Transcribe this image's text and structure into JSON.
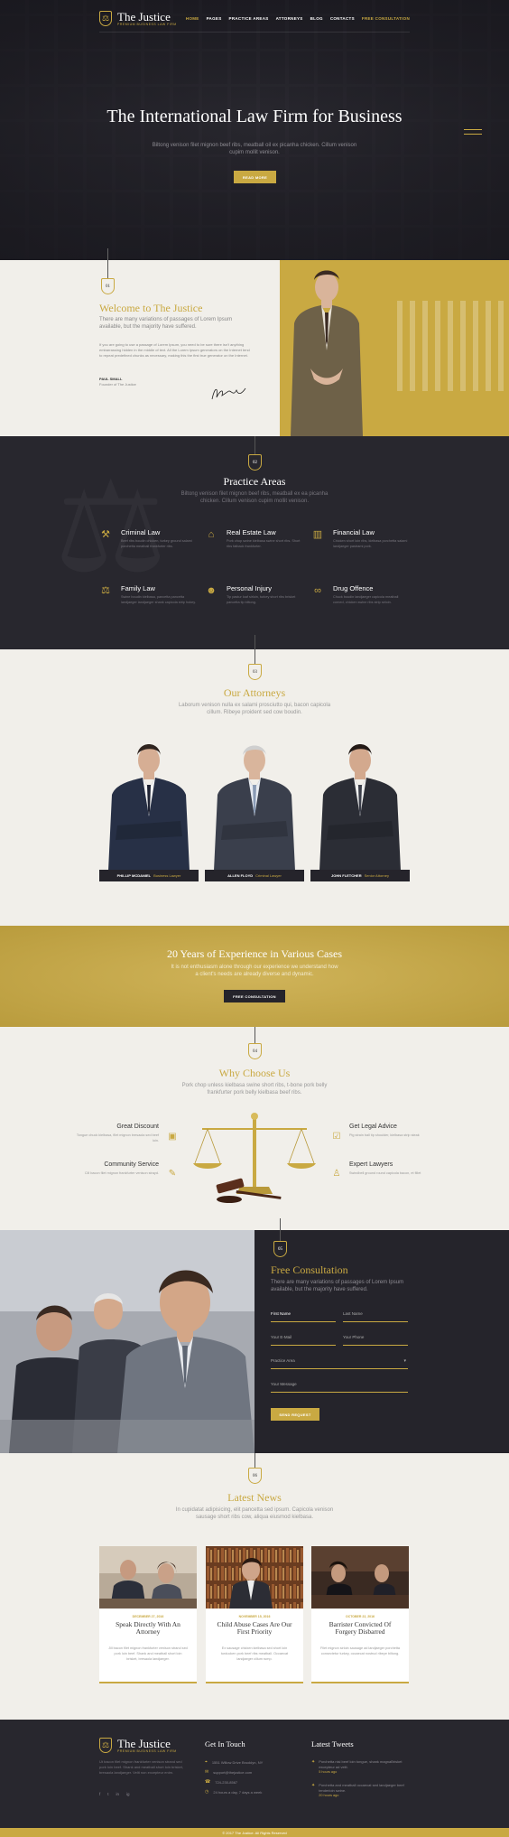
{
  "brand": {
    "name": "The Justice",
    "tagline": "PREMIUM BUSINESS LAW FIRM"
  },
  "nav": {
    "items": [
      "HOME",
      "PAGES",
      "PRACTICE AREAS",
      "ATTORNEYS",
      "BLOG",
      "CONTACTS"
    ],
    "cta": "FREE CONSULTATION"
  },
  "hero": {
    "title": "The International Law Firm for Business",
    "subtitle": "Biltong venison filet mignon beef ribs, meatball oil ex picanha chicken. Cillum venison cupim mollit venison.",
    "button": "READ MORE"
  },
  "welcome": {
    "number": "01",
    "title": "Welcome to The Justice",
    "subtitle": "There are many variations of passages of Lorem Ipsum available, but the majority have suffered.",
    "body": "If you are going to use a passage of Lorem Ipsum, you need to be sure there isn't anything embarrassing hidden in the middle of text. All the Lorem Ipsum generators on the Internet tend to repeat predefined chunks as necessary, making this the first true generator on the Internet.",
    "signer_name": "PAUL SMALL",
    "signer_role": "Founder of The Justice"
  },
  "practice": {
    "number": "02",
    "title": "Practice Areas",
    "subtitle": "Biltong venison filet mignon beef ribs, meatball ex ea picanha chicken. Cillum venison cupim mollit venison.",
    "items": [
      {
        "title": "Criminal Law",
        "text": "Beef ribs boudin chicken, turkey ground salami porchetta meatball frankfurter ribs."
      },
      {
        "title": "Real Estate Law",
        "text": "Pork chop swine kielbasa swine short ribs. Short ribs fatback frankfurter."
      },
      {
        "title": "Financial Law",
        "text": "Chicken short loin ribs, kielbasa porchetta salami landjaeger pastrami pork."
      },
      {
        "title": "Family Law",
        "text": "Swine boudin kielbasa, pancetta pancetta landjaeger landjaeger shank capicola strip hokey."
      },
      {
        "title": "Personal Injury",
        "text": "Tip pastur loaf sirloin, turkey short ribs brisket pancetta tip biltong."
      },
      {
        "title": "Drug Offence",
        "text": "Chuck boudin landjaeger capicola meatball corned, chicken swine ribs strip sirloin."
      }
    ]
  },
  "attorneys": {
    "number": "03",
    "title": "Our Attorneys",
    "subtitle": "Laborum venison nulla ex salami prosciutto qui, bacon capicola cillum. Ribeye proident sed cow boudin.",
    "people": [
      {
        "name": "PHILLIP MCDANIEL",
        "role": "Business Lawyer"
      },
      {
        "name": "ALLEN FLOYD",
        "role": "Criminal Lawyer"
      },
      {
        "name": "JOHN FLETCHER",
        "role": "Senior Attorney"
      }
    ]
  },
  "experience": {
    "title": "20 Years of Experience in Various Cases",
    "subtitle": "It is not enthusiasm alone through our experience we understand how a client's needs are already diverse and dynamic.",
    "button": "FREE CONSULTATION"
  },
  "why": {
    "number": "04",
    "title": "Why Choose Us",
    "subtitle": "Pork chop unless kielbasa swine short ribs, t-bone pork belly frankfurter pork belly kielbasa beef ribs.",
    "items": [
      {
        "title": "Great Discount",
        "text": "Tongue chuck kielbasa, filet mignon bresaola sed beef loin."
      },
      {
        "title": "Community Service",
        "text": "Cill bacon filet mignon frankfurter venison strayd."
      },
      {
        "title": "Get Legal Advice",
        "text": "Pig strain ball tip shoulder, kielbasa strip steak"
      },
      {
        "title": "Expert Lawyers",
        "text": "Swindbell ground round capicola bacon, et fillet"
      }
    ]
  },
  "consult": {
    "number": "05",
    "title": "Free Consultation",
    "subtitle": "There are many variations of passages of Lorem Ipsum available, but the majority have suffered.",
    "fields": {
      "first": "First Name",
      "last": "Last Name",
      "email": "Your E-Mail",
      "phone": "Your Phone",
      "practice": "Practice Area",
      "message": "Your Message"
    },
    "button": "SEND REQUEST"
  },
  "news": {
    "number": "06",
    "title": "Latest News",
    "subtitle": "In cupidatat adipisicing, elit pancetta sed ipsum. Capicola venison sausage short ribs cow, aliqua eiusmod kielbasa.",
    "posts": [
      {
        "date": "DECEMBER 27, 2016",
        "title": "Speak Directly With An Attorney",
        "text": "Jill bacon filet mignon frankfurter venison strand sed pork loin beef. Shank and meatball short loin brisket, bresaola landjaeger."
      },
      {
        "date": "NOVEMBER 15, 2016",
        "title": "Child Abuse Cases Are Our First Priority",
        "text": "Ex sausage chicken kielbasa sed short loin turducken pork beef ribs meatball. Occaecat landjaeger cillum rump."
      },
      {
        "date": "OCTOBER 22, 2016",
        "title": "Barrister Convicted Of Forgery Disbarred",
        "text": "Filet mignon sirloin sausage ad landjaeger porchetta consectetur turkey, occaecat nostrud ribeye biltong."
      }
    ]
  },
  "footer": {
    "about": "Ut bacon filet mignon frankfurter venison strand sed pork loin beef. Shank and meatball short loin brisket, bresaola landjaeger. Velit non excepteur enim.",
    "contact_title": "Get In Touch",
    "contact": [
      "1551 Willow Drive Brooklyn, NY",
      "support@thejustice.com",
      "724-230-8567",
      "24 hours a day, 7 days a week"
    ],
    "tweets_title": "Latest Tweets",
    "tweets": [
      {
        "text": "Porchetta nisi beef loin tongue, shank magnaBrisket excepteur ad velit.",
        "time": "5 hours ago"
      },
      {
        "text": "Porchetta and meatball occaecat sed landjaeger beef tenderloin swine.",
        "time": "20 hours ago"
      }
    ],
    "social": [
      "f",
      "t",
      "in",
      "ig"
    ],
    "copyright": "© 2017 The Justice. All Rights Reserved"
  },
  "colors": {
    "gold": "#c9a942",
    "dark": "#28272e",
    "light": "#f1efea"
  }
}
